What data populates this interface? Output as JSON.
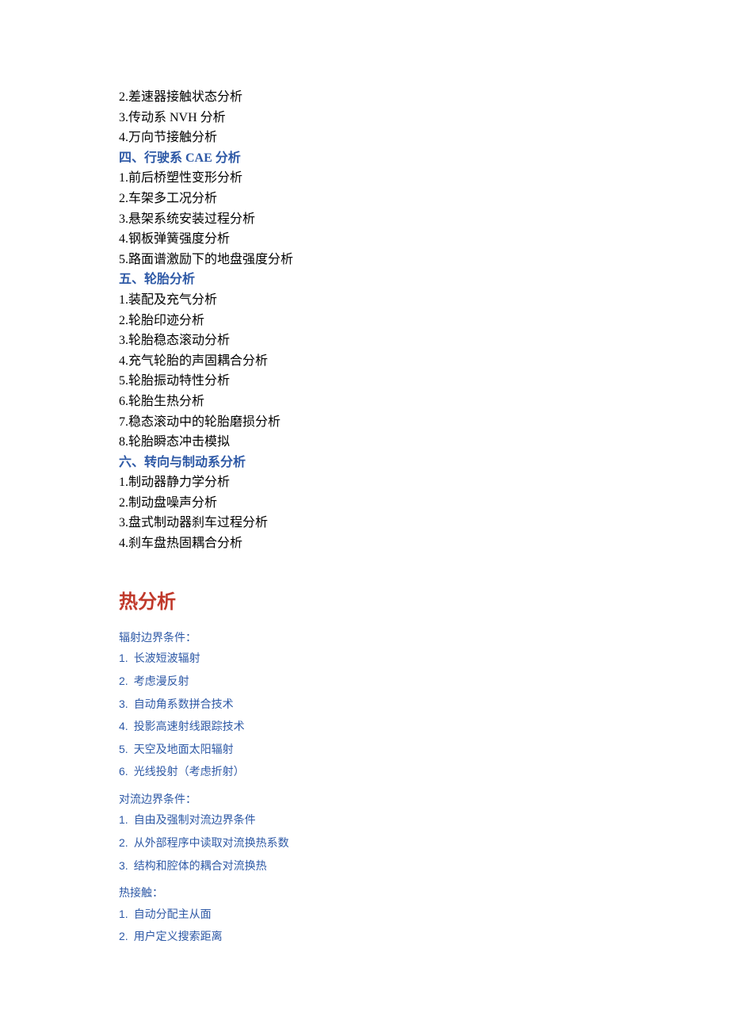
{
  "section3_tail": [
    "2.差速器接触状态分析",
    "3.传动系 NVH 分析",
    "4.万向节接触分析"
  ],
  "sec4": {
    "title": "四、行驶系 CAE 分析",
    "items": [
      "1.前后桥塑性变形分析",
      "2.车架多工况分析",
      "3.悬架系统安装过程分析",
      "4.钢板弹簧强度分析",
      "5.路面谱激励下的地盘强度分析"
    ]
  },
  "sec5": {
    "title": "五、轮胎分析",
    "items": [
      "1.装配及充气分析",
      "2.轮胎印迹分析",
      "3.轮胎稳态滚动分析",
      "4.充气轮胎的声固耦合分析",
      "5.轮胎振动特性分析",
      "6.轮胎生热分析",
      "7.稳态滚动中的轮胎磨损分析",
      "8.轮胎瞬态冲击模拟"
    ]
  },
  "sec6": {
    "title": "六、转向与制动系分析",
    "items": [
      "1.制动器静力学分析",
      "2.制动盘噪声分析",
      "3.盘式制动器刹车过程分析",
      "4.刹车盘热固耦合分析"
    ]
  },
  "thermal": {
    "title": "热分析",
    "groups": [
      {
        "label": "辐射边界条件：",
        "items": [
          "长波短波辐射",
          "考虑漫反射",
          "自动角系数拼合技术",
          "投影高速射线跟踪技术",
          "天空及地面太阳辐射",
          "光线投射（考虑折射）"
        ]
      },
      {
        "label": "对流边界条件：",
        "items": [
          "自由及强制对流边界条件",
          "从外部程序中读取对流换热系数",
          "结构和腔体的耦合对流换热"
        ]
      },
      {
        "label": "热接触：",
        "items": [
          "自动分配主从面",
          "用户定义搜索距离"
        ]
      }
    ]
  }
}
